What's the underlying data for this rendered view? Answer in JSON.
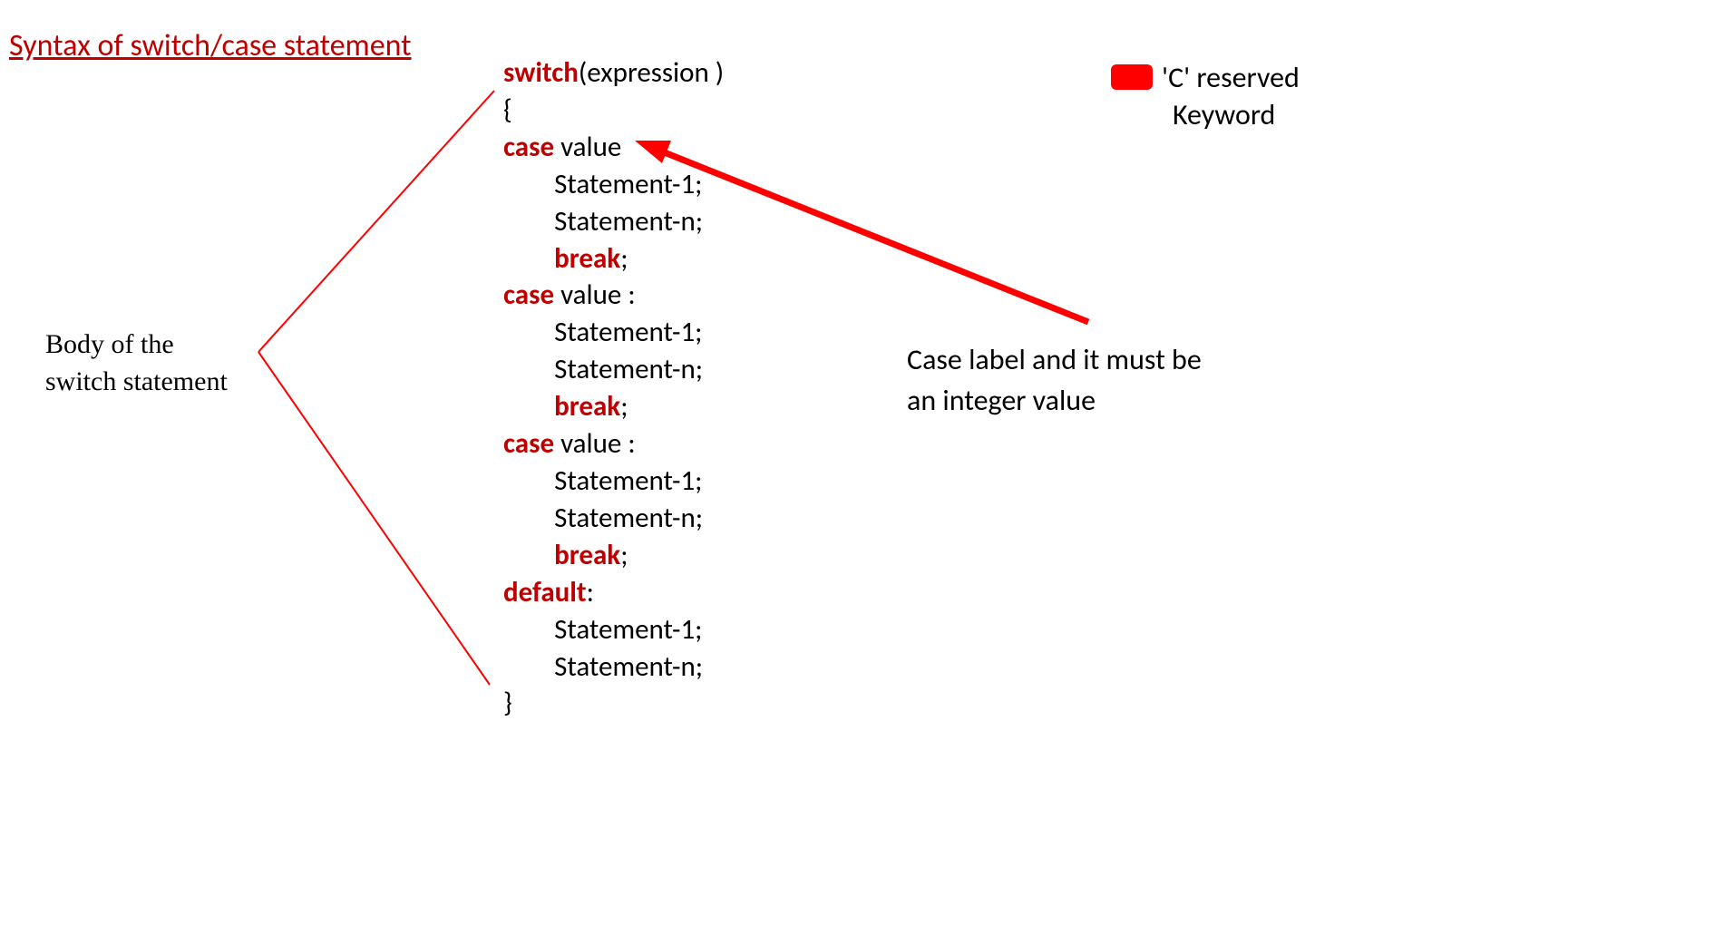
{
  "title": "Syntax of switch/case statement",
  "legend": {
    "line1": "'C' reserved",
    "line2": "Keyword",
    "color": "#ff0000"
  },
  "body_label": {
    "line1": "Body of the",
    "line2": "switch statement"
  },
  "case_label": {
    "line1": "Case label and it must be",
    "line2": "an integer value"
  },
  "code": {
    "kw_switch": "switch",
    "expression": "(expression )",
    "brace_open": "{",
    "kw_case": "case",
    "case_value_first": " value",
    "case_value": " value :",
    "stmt1": "Statement-1;",
    "stmtn": "Statement-n;",
    "kw_break": "break",
    "semi": ";",
    "kw_default": "default",
    "colon": ":",
    "brace_close": "}"
  }
}
